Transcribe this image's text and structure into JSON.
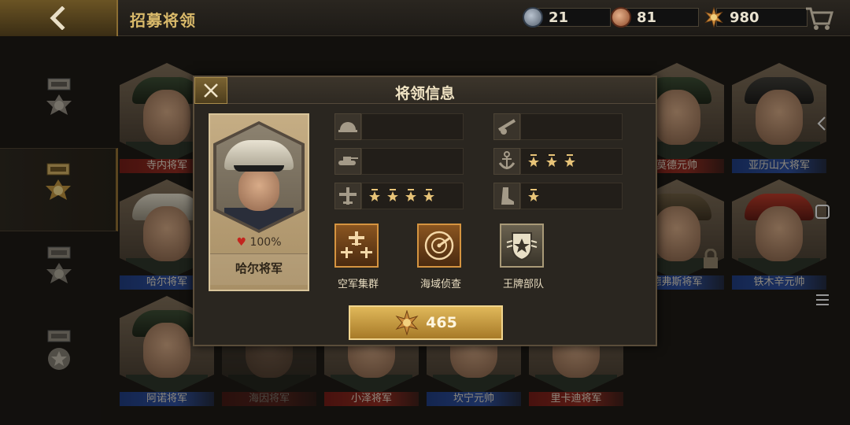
{
  "header": {
    "title": "招募将领",
    "resources": [
      {
        "name": "medal-blue",
        "value": "21"
      },
      {
        "name": "medal-bronze",
        "value": "81"
      },
      {
        "name": "gold-badge",
        "value": "980"
      }
    ]
  },
  "background_generals": [
    {
      "name": "寺内将军",
      "band": "red"
    },
    {
      "name": "莫德元帅",
      "band": "red"
    },
    {
      "name": "亚历山大将军",
      "band": "blue"
    },
    {
      "name": "哈尔将军",
      "band": "blue"
    },
    {
      "name": "德弗斯将军",
      "band": "blue"
    },
    {
      "name": "铁木辛元帅",
      "band": "blue"
    },
    {
      "name": "阿诺将军",
      "band": "blue"
    },
    {
      "name": "海因将军",
      "band": "red"
    },
    {
      "name": "小泽将军",
      "band": "red"
    },
    {
      "name": "坎宁元帅",
      "band": "blue"
    },
    {
      "name": "里卡迪将军",
      "band": "red"
    }
  ],
  "modal": {
    "title": "将领信息",
    "general": {
      "name": "哈尔将军",
      "loyalty": "100%"
    },
    "stats": [
      {
        "name": "infantry",
        "stars": 0
      },
      {
        "name": "artillery",
        "stars": 0
      },
      {
        "name": "tank",
        "stars": 0
      },
      {
        "name": "navy",
        "stars": 3
      },
      {
        "name": "air-force",
        "stars": 4
      },
      {
        "name": "cavalry",
        "stars": 1
      }
    ],
    "skills": [
      {
        "label": "空军集群",
        "icon": "air-group-icon"
      },
      {
        "label": "海域侦查",
        "icon": "sea-radar-icon"
      },
      {
        "label": "王牌部队",
        "icon": "ace-troops-icon"
      }
    ],
    "price": "465"
  },
  "colors": {
    "gold": "#d9b96a",
    "accent_orange": "#d59440",
    "band_blue": "#2c4c96",
    "band_red": "#8a2a20"
  }
}
